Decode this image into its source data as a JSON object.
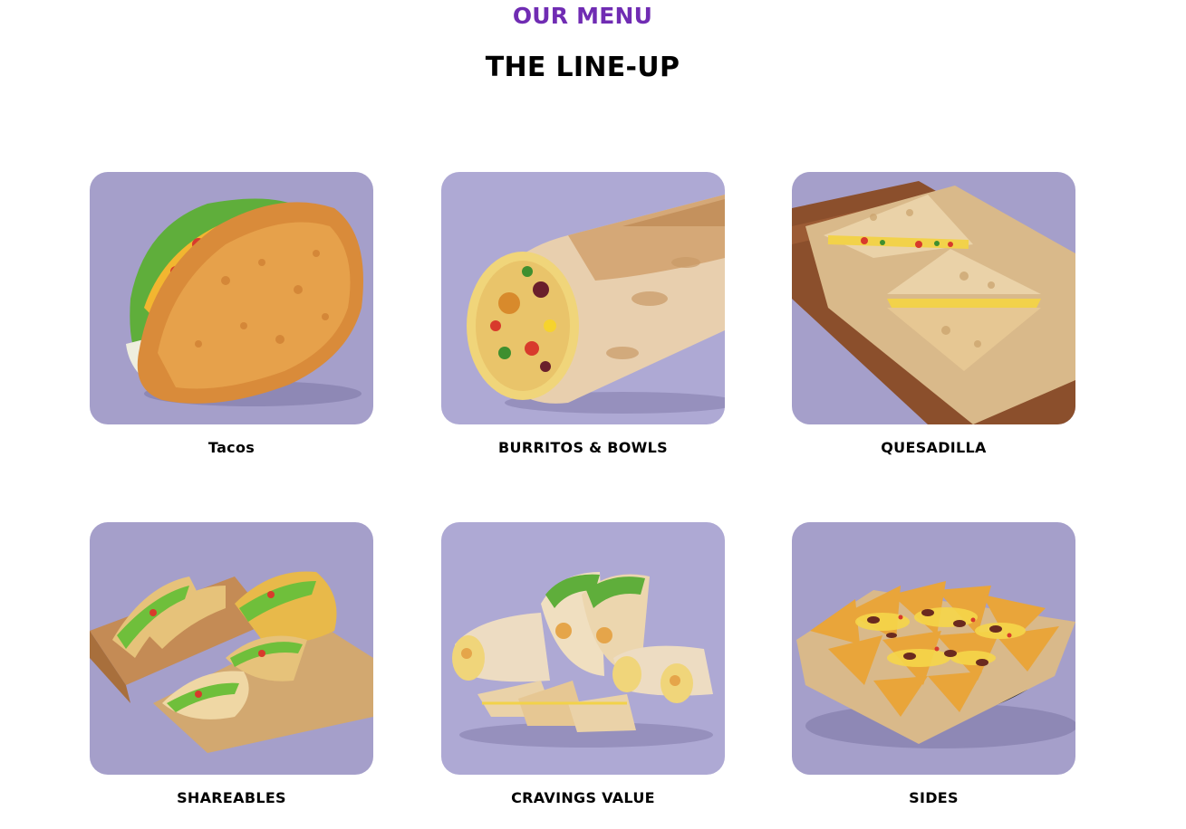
{
  "header": {
    "eyebrow": "OUR MENU",
    "title": "THE LINE-UP"
  },
  "colors": {
    "accent": "#702cb3",
    "tile_background": "#a59fca",
    "tile_background_alt": "#aea9d4"
  },
  "menu": {
    "items": [
      {
        "label": "Tacos",
        "image": "crispy-taco-image"
      },
      {
        "label": "BURRITOS & BOWLS",
        "image": "burrito-image"
      },
      {
        "label": "QUESADILLA",
        "image": "quesadilla-image"
      },
      {
        "label": "SHAREABLES",
        "image": "taco-box-image"
      },
      {
        "label": "CRAVINGS VALUE",
        "image": "value-meal-image"
      },
      {
        "label": "SIDES",
        "image": "nachos-image"
      }
    ]
  }
}
